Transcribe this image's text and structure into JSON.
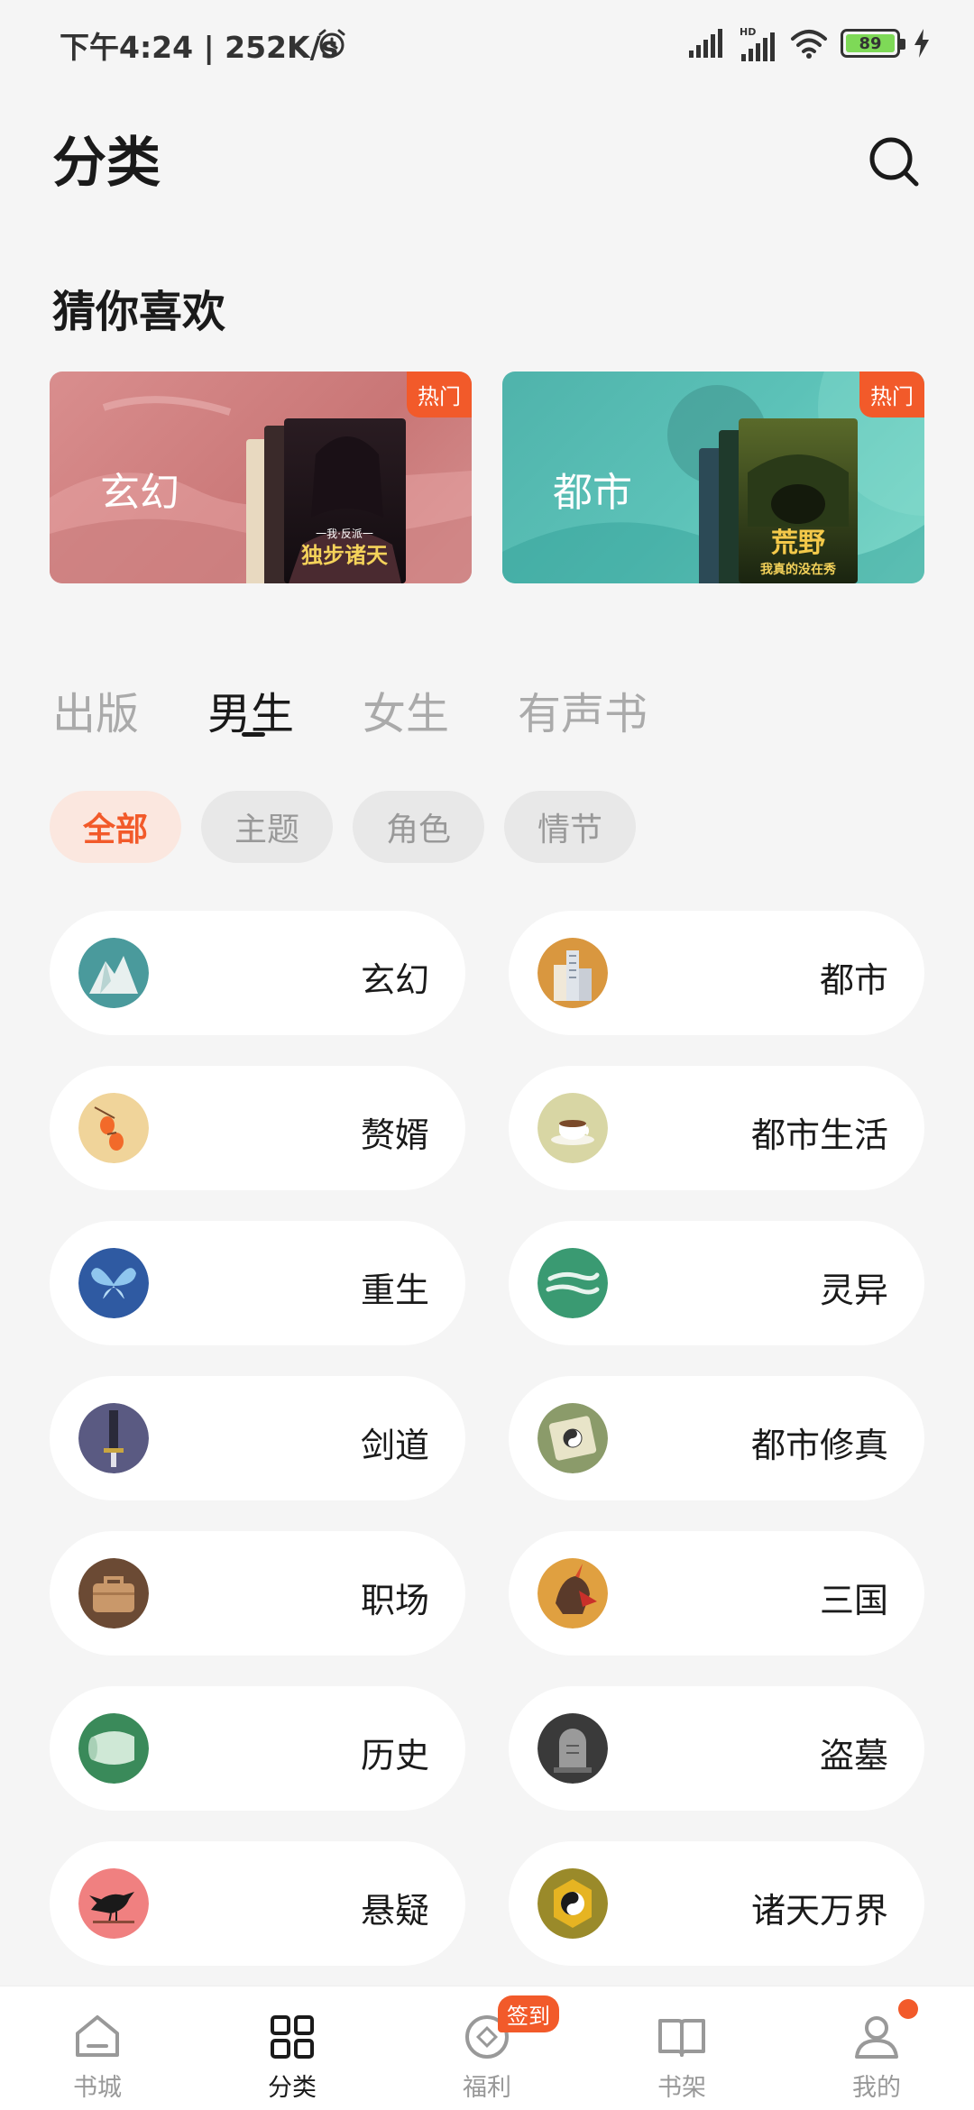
{
  "status_bar": {
    "time": "下午4:24 | 252K/s",
    "battery": "89",
    "hd_label": "HD"
  },
  "header": {
    "title": "分类"
  },
  "recommend": {
    "title": "猜你喜欢",
    "cards": [
      {
        "label": "玄幻",
        "badge": "热门",
        "cover_text": "独步诸天",
        "cover_subtext": "一我·反派一"
      },
      {
        "label": "都市",
        "badge": "热门",
        "cover_text": "荒野",
        "cover_subtext": "我真的没在秀"
      }
    ]
  },
  "tabs": [
    {
      "label": "出版"
    },
    {
      "label": "男生"
    },
    {
      "label": "女生"
    },
    {
      "label": "有声书"
    }
  ],
  "chips": [
    {
      "label": "全部"
    },
    {
      "label": "主题"
    },
    {
      "label": "角色"
    },
    {
      "label": "情节"
    }
  ],
  "categories": [
    {
      "label": "玄幻",
      "icon": "mountain-icon",
      "color": "#4a9a9c"
    },
    {
      "label": "都市",
      "icon": "buildings-icon",
      "color": "#d9973f"
    },
    {
      "label": "赘婿",
      "icon": "lantern-icon",
      "color": "#f0d49a"
    },
    {
      "label": "都市生活",
      "icon": "coffee-cup-icon",
      "color": "#d8d6a4"
    },
    {
      "label": "重生",
      "icon": "butterfly-icon",
      "color": "#2f5aa2"
    },
    {
      "label": "灵异",
      "icon": "wind-swirl-icon",
      "color": "#3a9a72"
    },
    {
      "label": "剑道",
      "icon": "sword-icon",
      "color": "#5a5a82"
    },
    {
      "label": "都市修真",
      "icon": "taiji-scroll-icon",
      "color": "#8b9b6a"
    },
    {
      "label": "职场",
      "icon": "briefcase-icon",
      "color": "#6b4a34"
    },
    {
      "label": "三国",
      "icon": "warrior-helmet-icon",
      "color": "#e0a040"
    },
    {
      "label": "历史",
      "icon": "scroll-icon",
      "color": "#3a8a5a"
    },
    {
      "label": "盗墓",
      "icon": "tombstone-icon",
      "color": "#3a3a3a"
    },
    {
      "label": "悬疑",
      "icon": "crow-icon",
      "color": "#f08080"
    },
    {
      "label": "诸天万界",
      "icon": "taiji-coin-icon",
      "color": "#9a8a2a"
    }
  ],
  "bottom_nav": [
    {
      "label": "书城",
      "icon": "home-icon"
    },
    {
      "label": "分类",
      "icon": "grid-icon"
    },
    {
      "label": "福利",
      "icon": "coin-icon",
      "badge": "签到"
    },
    {
      "label": "书架",
      "icon": "book-open-icon"
    },
    {
      "label": "我的",
      "icon": "user-icon"
    }
  ],
  "colors": {
    "accent": "#f25a2a",
    "background": "#f5f5f5"
  }
}
